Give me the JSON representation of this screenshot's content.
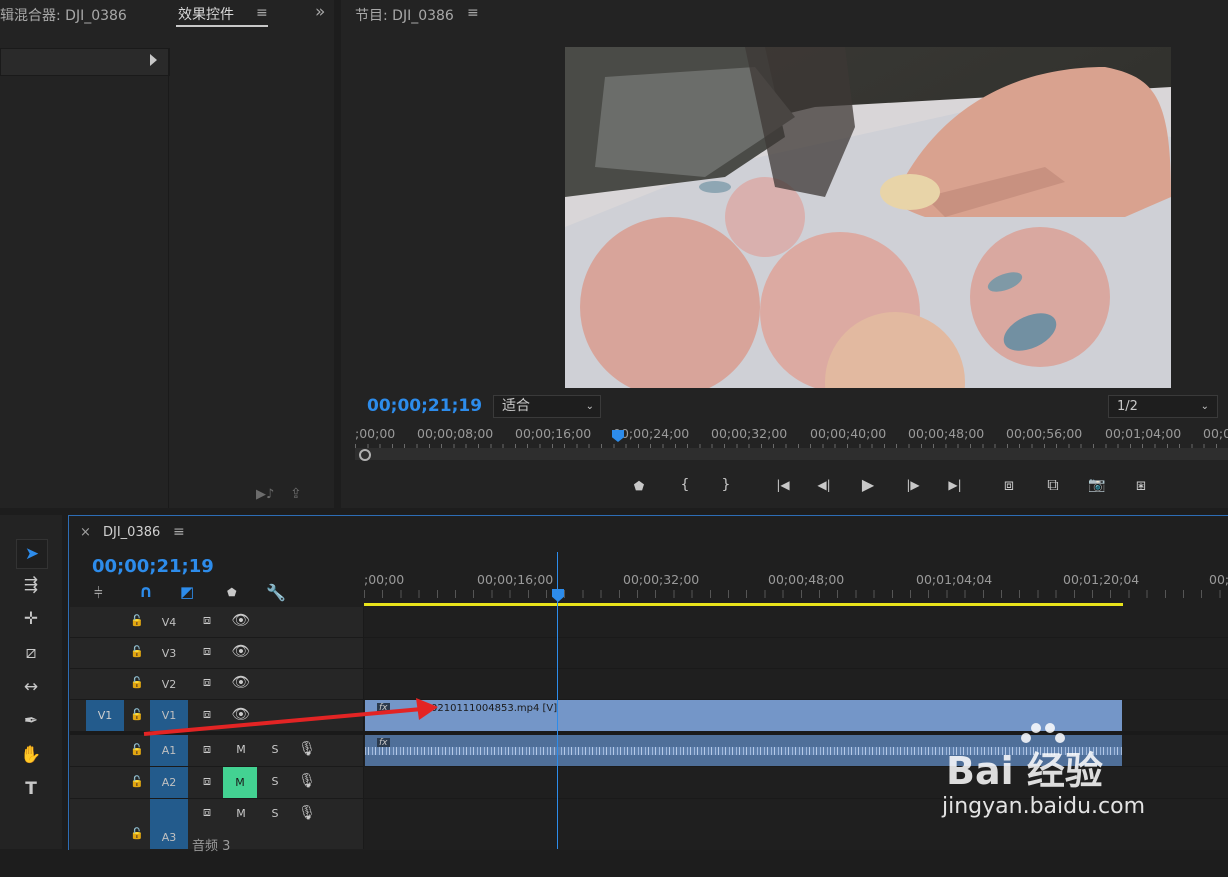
{
  "left_panel": {
    "tab_mixer": "辑混合器: DJI_0386",
    "tab_effects": "效果控件",
    "menu": "≡",
    "overflow": "»"
  },
  "program": {
    "title": "节目: DJI_0386",
    "menu": "≡",
    "timecode": "00;00;21;19",
    "fit": "适合",
    "resolution": "1/2",
    "ruler": [
      ";00;00",
      "00;00;08;00",
      "00;00;16;00",
      "00;00;24;00",
      "00;00;32;00",
      "00;00;40;00",
      "00;00;48;00",
      "00;00;56;00",
      "00;01;04;00",
      "00;0"
    ],
    "playhead_fraction": 0.33
  },
  "transport": {
    "marker": "⬟",
    "in": "{",
    "out": "}",
    "goto_in": "|◀",
    "step_back": "◀|",
    "play": "▶",
    "step_fwd": "|▶",
    "goto_out": "▶|",
    "lift": "⧈",
    "extract": "⧉",
    "export_frame": "📷",
    "compare": "⧆"
  },
  "timeline": {
    "close": "×",
    "sequence": "DJI_0386",
    "menu": "≡",
    "timecode": "00;00;21;19",
    "ruler": [
      ";00;00",
      "00;00;16;00",
      "00;00;32;00",
      "00;00;48;00",
      "00;01;04;04",
      "00;01;20;04",
      "00;"
    ],
    "tracks": [
      {
        "name": "V4",
        "source": ""
      },
      {
        "name": "V3",
        "source": ""
      },
      {
        "name": "V2",
        "source": ""
      },
      {
        "name": "V1",
        "source": "V1"
      },
      {
        "name": "A1",
        "source": ""
      },
      {
        "name": "A2",
        "source": ""
      },
      {
        "name": "A3",
        "source": ""
      }
    ],
    "mute_label": "M",
    "solo_label": "S",
    "audio3_label": "音频 3",
    "clip_name": "0210111004853.mp4 [V]",
    "fx_label": "fx"
  },
  "watermark": {
    "brand": "Bai 经验",
    "url": "jingyan.baidu.com"
  },
  "colors": {
    "accent_blue": "#2d8ceb",
    "clip_video": "#7496c8",
    "clip_audio": "#4f6f99",
    "mute_green": "#43d292",
    "work_area": "#e8e31b",
    "arrow_red": "#e32424"
  }
}
